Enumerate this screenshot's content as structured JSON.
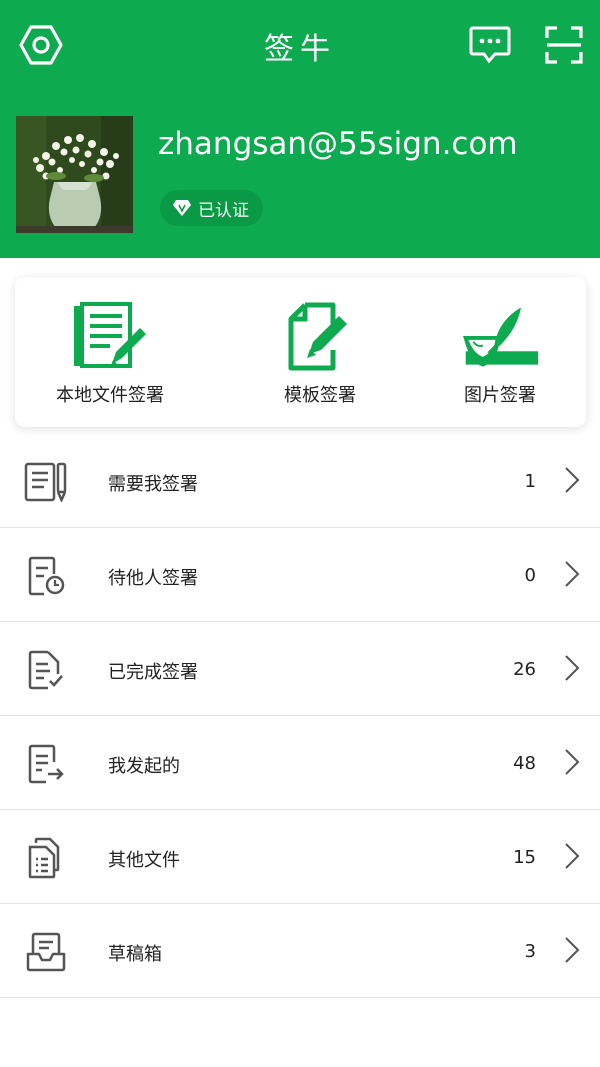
{
  "header": {
    "title": "签牛",
    "settings_icon": "hex-settings-icon",
    "message_icon": "chat-icon",
    "scan_icon": "scan-icon",
    "email": "zhangsan@55sign.com",
    "verified_label": "已认证",
    "brand_color": "#0daa4f"
  },
  "shortcuts": [
    {
      "label": "本地文件签署",
      "icon": "local-file-sign-icon"
    },
    {
      "label": "模板签署",
      "icon": "template-sign-icon"
    },
    {
      "label": "图片签署",
      "icon": "image-sign-icon"
    }
  ],
  "list": [
    {
      "label": "需要我签署",
      "count": "1",
      "icon": "doc-pen-icon"
    },
    {
      "label": "待他人签署",
      "count": "0",
      "icon": "doc-clock-icon"
    },
    {
      "label": "已完成签署",
      "count": "26",
      "icon": "doc-check-icon"
    },
    {
      "label": "我发起的",
      "count": "48",
      "icon": "doc-send-icon"
    },
    {
      "label": "其他文件",
      "count": "15",
      "icon": "doc-stack-icon"
    },
    {
      "label": "草稿箱",
      "count": "3",
      "icon": "inbox-icon"
    }
  ]
}
